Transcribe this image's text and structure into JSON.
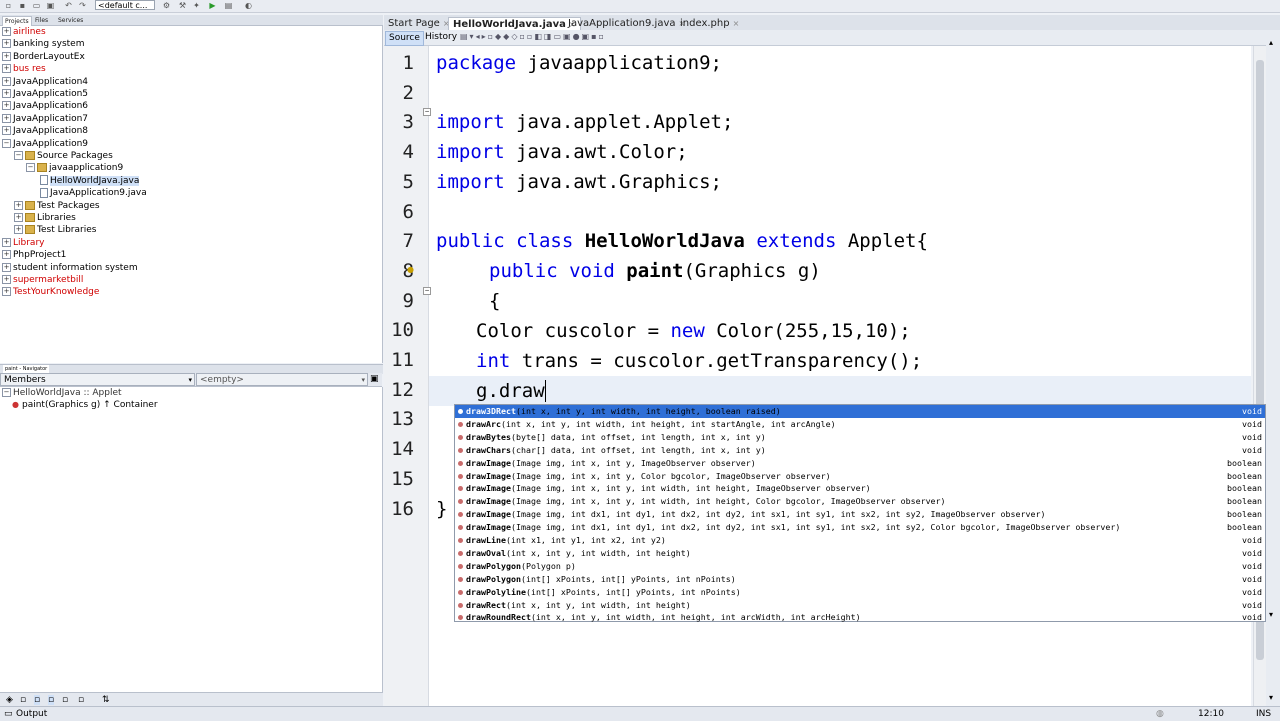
{
  "toolbar": {
    "config": "<default c..."
  },
  "left_tabs": [
    "Projects",
    "Files",
    "Services"
  ],
  "tree": [
    {
      "label": "airlines",
      "level": 0,
      "exp": "+",
      "red": true
    },
    {
      "label": "banking system",
      "level": 0,
      "exp": "+",
      "red": false
    },
    {
      "label": "BorderLayoutEx",
      "level": 0,
      "exp": "+",
      "red": false
    },
    {
      "label": "bus res",
      "level": 0,
      "exp": "+",
      "red": true
    },
    {
      "label": "JavaApplication4",
      "level": 0,
      "exp": "+",
      "red": false
    },
    {
      "label": "JavaApplication5",
      "level": 0,
      "exp": "+",
      "red": false
    },
    {
      "label": "JavaApplication6",
      "level": 0,
      "exp": "+",
      "red": false
    },
    {
      "label": "JavaApplication7",
      "level": 0,
      "exp": "+",
      "red": false
    },
    {
      "label": "JavaApplication8",
      "level": 0,
      "exp": "+",
      "red": false
    },
    {
      "label": "JavaApplication9",
      "level": 0,
      "exp": "-",
      "red": false
    },
    {
      "label": "Source Packages",
      "level": 1,
      "exp": "-",
      "red": false
    },
    {
      "label": "javaapplication9",
      "level": 2,
      "exp": "-",
      "red": false
    },
    {
      "label": "HelloWorldJava.java",
      "level": 3,
      "exp": "",
      "red": false,
      "sel": true,
      "file": true
    },
    {
      "label": "JavaApplication9.java",
      "level": 3,
      "exp": "",
      "red": false,
      "file": true
    },
    {
      "label": "Test Packages",
      "level": 1,
      "exp": "+",
      "red": false
    },
    {
      "label": "Libraries",
      "level": 1,
      "exp": "+",
      "red": false
    },
    {
      "label": "Test Libraries",
      "level": 1,
      "exp": "+",
      "red": false
    },
    {
      "label": "Library",
      "level": 0,
      "exp": "+",
      "red": true
    },
    {
      "label": "PhpProject1",
      "level": 0,
      "exp": "+",
      "red": false
    },
    {
      "label": "student information system",
      "level": 0,
      "exp": "+",
      "red": false
    },
    {
      "label": "supermarketbill",
      "level": 0,
      "exp": "+",
      "red": true
    },
    {
      "label": "TestYourKnowledge",
      "level": 0,
      "exp": "+",
      "red": true
    }
  ],
  "navigator": {
    "tab": "paint - Navigator",
    "members": "Members",
    "empty": "<empty>",
    "class": "HelloWorldJava :: Applet",
    "method": "paint(Graphics g) ↑ Container"
  },
  "editor_tabs": [
    "Start Page",
    "HelloWorldJava.java",
    "JavaApplication9.java",
    "index.php"
  ],
  "editor_bar": {
    "source": "Source",
    "history": "History"
  },
  "line_numbers": [
    "1",
    "2",
    "3",
    "4",
    "5",
    "6",
    "7",
    "8",
    "9",
    "10",
    "11",
    "12",
    "13",
    "14",
    "15",
    "16"
  ],
  "code": {
    "l1_kw": "package",
    "l1_rest": " javaapplication9;",
    "l3_kw": "import",
    "l3_rest": " java.applet.Applet;",
    "l4_kw": "import",
    "l4_rest": " java.awt.Color;",
    "l5_kw": "import",
    "l5_rest": " java.awt.Graphics;",
    "l7_kw1": "public class",
    "l7_cls": " HelloWorldJava",
    "l7_kw2": " extends",
    "l7_rest": " Applet{",
    "l8_kw": "public void",
    "l8_m": " paint",
    "l8_rest": "(Graphics g)",
    "l9": "{",
    "l10_a": "Color cuscolor = ",
    "l10_kw": "new",
    "l10_b": " Color(255,15,10);",
    "l11_kw": "int",
    "l11_rest": " trans = cuscolor.getTransparency();",
    "l12": "g.draw",
    "l16": "}"
  },
  "completion": [
    {
      "name": "draw3DRect",
      "params": "(int x, int y, int width, int height, boolean raised)",
      "ret": "void"
    },
    {
      "name": "drawArc",
      "params": "(int x, int y, int width, int height, int startAngle, int arcAngle)",
      "ret": "void"
    },
    {
      "name": "drawBytes",
      "params": "(byte[] data, int offset, int length, int x, int y)",
      "ret": "void"
    },
    {
      "name": "drawChars",
      "params": "(char[] data, int offset, int length, int x, int y)",
      "ret": "void"
    },
    {
      "name": "drawImage",
      "params": "(Image img, int x, int y, ImageObserver observer)",
      "ret": "boolean"
    },
    {
      "name": "drawImage",
      "params": "(Image img, int x, int y, Color bgcolor, ImageObserver observer)",
      "ret": "boolean"
    },
    {
      "name": "drawImage",
      "params": "(Image img, int x, int y, int width, int height, ImageObserver observer)",
      "ret": "boolean"
    },
    {
      "name": "drawImage",
      "params": "(Image img, int x, int y, int width, int height, Color bgcolor, ImageObserver observer)",
      "ret": "boolean"
    },
    {
      "name": "drawImage",
      "params": "(Image img, int dx1, int dy1, int dx2, int dy2, int sx1, int sy1, int sx2, int sy2, ImageObserver observer)",
      "ret": "boolean"
    },
    {
      "name": "drawImage",
      "params": "(Image img, int dx1, int dy1, int dx2, int dy2, int sx1, int sy1, int sx2, int sy2, Color bgcolor, ImageObserver observer)",
      "ret": "boolean"
    },
    {
      "name": "drawLine",
      "params": "(int x1, int y1, int x2, int y2)",
      "ret": "void"
    },
    {
      "name": "drawOval",
      "params": "(int x, int y, int width, int height)",
      "ret": "void"
    },
    {
      "name": "drawPolygon",
      "params": "(Polygon p)",
      "ret": "void"
    },
    {
      "name": "drawPolygon",
      "params": "(int[] xPoints, int[] yPoints, int nPoints)",
      "ret": "void"
    },
    {
      "name": "drawPolyline",
      "params": "(int[] xPoints, int[] yPoints, int nPoints)",
      "ret": "void"
    },
    {
      "name": "drawRect",
      "params": "(int x, int y, int width, int height)",
      "ret": "void"
    },
    {
      "name": "drawRoundRect",
      "params": "(int x, int y, int width, int height, int arcWidth, int arcHeight)",
      "ret": "void"
    }
  ],
  "status": {
    "output": "Output",
    "position": "12:10",
    "mode": "INS"
  }
}
